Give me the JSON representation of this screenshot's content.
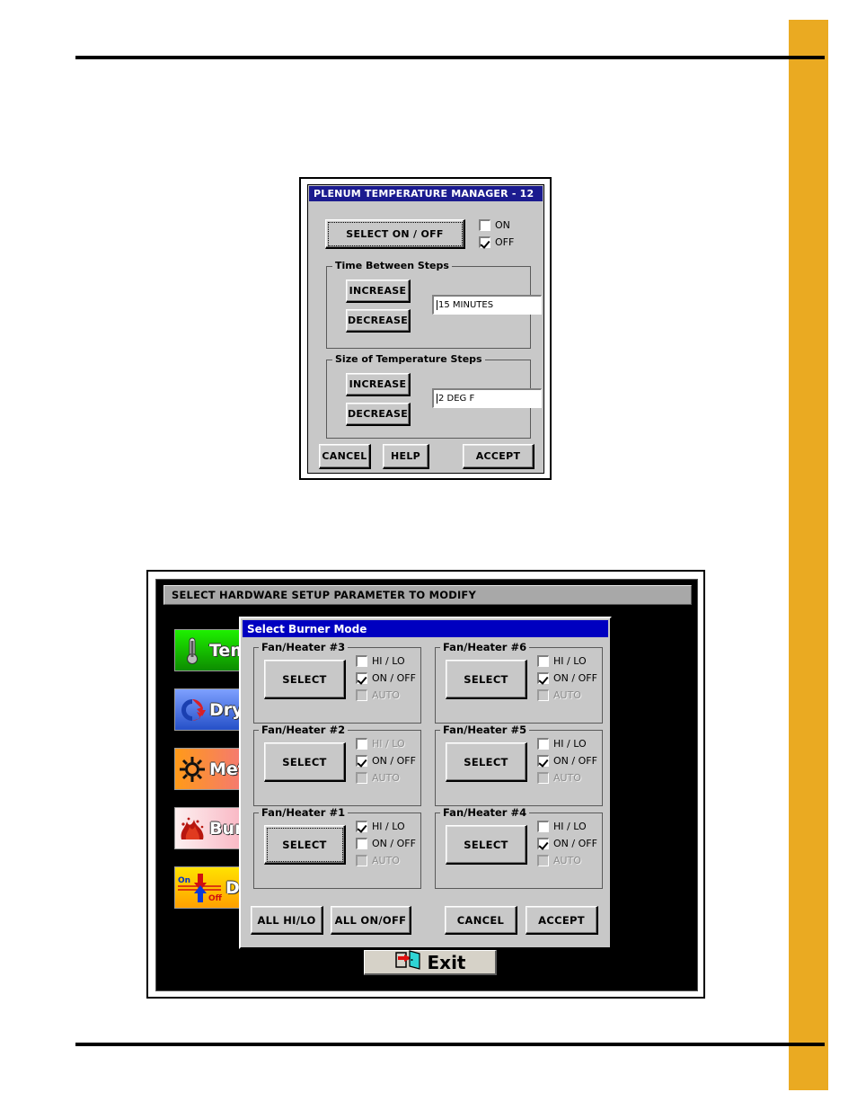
{
  "page": {
    "background": "#ffffff",
    "accent_band_color": "#eaaa22",
    "rule_color": "#000000"
  },
  "dialog_plenum": {
    "title": "PLENUM TEMPERATURE MANAGER - 12",
    "titlebar_color": "#1b1b8f",
    "select_on_off_button": "SELECT ON / OFF",
    "select_on_off_focused": true,
    "power_checkboxes": [
      {
        "label": "ON",
        "checked": false
      },
      {
        "label": "OFF",
        "checked": true
      }
    ],
    "group_time": {
      "title": "Time Between Steps",
      "increase_label": "INCREASE",
      "decrease_label": "DECREASE",
      "value": "15 MINUTES"
    },
    "group_size": {
      "title": "Size of Temperature Steps",
      "increase_label": "INCREASE",
      "decrease_label": "DECREASE",
      "value": "2 DEG F"
    },
    "buttons": {
      "cancel": "CANCEL",
      "help": "HELP",
      "accept": "ACCEPT"
    }
  },
  "hardware_screen": {
    "header": "SELECT HARDWARE SETUP PARAMETER TO MODIFY",
    "header_bg": "#a8a8a8",
    "screen_bg": "#000000",
    "sidebar_items": [
      {
        "label": "Tem",
        "icon": "thermometer-icon",
        "color_from": "#12e000",
        "color_to": "#0f9b00"
      },
      {
        "label": "Dry",
        "icon": "recycle-arrows-icon",
        "color_from": "#5e86f5",
        "color_to": "#2f5fd4"
      },
      {
        "label": "Meter ",
        "icon": "sun-gear-icon",
        "color_from": "#ff9a18",
        "color_to": "#f06a9a"
      },
      {
        "label": "Burn",
        "icon": "flame-icon",
        "color_from": "#fdecec",
        "color_to": "#f7a9b8"
      },
      {
        "label": "Dr",
        "icon": "on-off-arrows-icon",
        "color_from": "#ffe200",
        "color_to": "#ffa400"
      }
    ],
    "exit_button": {
      "label": "Exit",
      "icon": "exit-door-icon"
    }
  },
  "dialog_burner": {
    "title": "Select Burner Mode",
    "titlebar_color": "#0000c0",
    "select_label": "SELECT",
    "mode_labels": {
      "hilo": "HI / LO",
      "onoff": "ON / OFF",
      "auto": "AUTO"
    },
    "groups_left": [
      {
        "title": "Fan/Heater #3",
        "select_focused": false,
        "modes": [
          {
            "key": "hilo",
            "checked": false,
            "disabled": false
          },
          {
            "key": "onoff",
            "checked": true,
            "disabled": false
          },
          {
            "key": "auto",
            "checked": false,
            "disabled": true
          }
        ]
      },
      {
        "title": "Fan/Heater #2",
        "select_focused": false,
        "modes": [
          {
            "key": "hilo",
            "checked": false,
            "disabled": true
          },
          {
            "key": "onoff",
            "checked": true,
            "disabled": false
          },
          {
            "key": "auto",
            "checked": false,
            "disabled": true
          }
        ]
      },
      {
        "title": "Fan/Heater #1",
        "select_focused": true,
        "modes": [
          {
            "key": "hilo",
            "checked": true,
            "disabled": false
          },
          {
            "key": "onoff",
            "checked": false,
            "disabled": false
          },
          {
            "key": "auto",
            "checked": false,
            "disabled": true
          }
        ]
      }
    ],
    "groups_right": [
      {
        "title": "Fan/Heater #6",
        "select_focused": false,
        "modes": [
          {
            "key": "hilo",
            "checked": false,
            "disabled": false
          },
          {
            "key": "onoff",
            "checked": true,
            "disabled": false
          },
          {
            "key": "auto",
            "checked": false,
            "disabled": true
          }
        ]
      },
      {
        "title": "Fan/Heater #5",
        "select_focused": false,
        "modes": [
          {
            "key": "hilo",
            "checked": false,
            "disabled": false
          },
          {
            "key": "onoff",
            "checked": true,
            "disabled": false
          },
          {
            "key": "auto",
            "checked": false,
            "disabled": true
          }
        ]
      },
      {
        "title": "Fan/Heater #4",
        "select_focused": false,
        "modes": [
          {
            "key": "hilo",
            "checked": false,
            "disabled": false
          },
          {
            "key": "onoff",
            "checked": true,
            "disabled": false
          },
          {
            "key": "auto",
            "checked": false,
            "disabled": true
          }
        ]
      }
    ],
    "buttons": {
      "all_hilo": "ALL HI/LO",
      "all_onoff": "ALL ON/OFF",
      "cancel": "CANCEL",
      "accept": "ACCEPT"
    }
  }
}
